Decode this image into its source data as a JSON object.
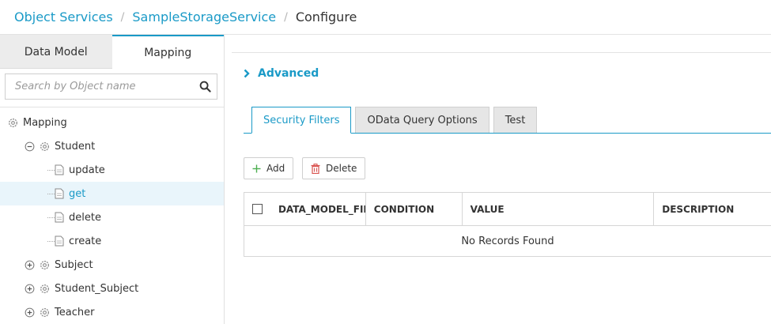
{
  "breadcrumb": {
    "items": [
      "Object Services",
      "SampleStorageService"
    ],
    "current": "Configure"
  },
  "sidebar": {
    "tabs": [
      {
        "label": "Data Model",
        "active": false
      },
      {
        "label": "Mapping",
        "active": true
      }
    ],
    "search": {
      "placeholder": "Search by Object name",
      "value": "",
      "icon": "search-icon"
    },
    "tree": {
      "root": "Mapping",
      "nodes": [
        {
          "label": "Student",
          "expanded": true,
          "children": [
            {
              "label": "update",
              "selected": false
            },
            {
              "label": "get",
              "selected": true
            },
            {
              "label": "delete",
              "selected": false
            },
            {
              "label": "create",
              "selected": false
            }
          ]
        },
        {
          "label": "Subject",
          "expanded": false
        },
        {
          "label": "Student_Subject",
          "expanded": false
        },
        {
          "label": "Teacher",
          "expanded": false
        }
      ]
    }
  },
  "main": {
    "advanced_label": "Advanced",
    "tabs": [
      {
        "label": "Security Filters",
        "active": true
      },
      {
        "label": "OData Query Options",
        "active": false
      },
      {
        "label": "Test",
        "active": false
      }
    ],
    "actions": {
      "add_label": "Add",
      "delete_label": "Delete"
    },
    "grid": {
      "columns": [
        "DATA_MODEL_FIELD",
        "CONDITION",
        "VALUE",
        "DESCRIPTION"
      ],
      "empty_text": "No Records Found"
    }
  },
  "colors": {
    "accent": "#1a9ac7",
    "add_green": "#4caf50",
    "delete_red": "#d9534f",
    "selected_row": "#e9f5fb"
  }
}
